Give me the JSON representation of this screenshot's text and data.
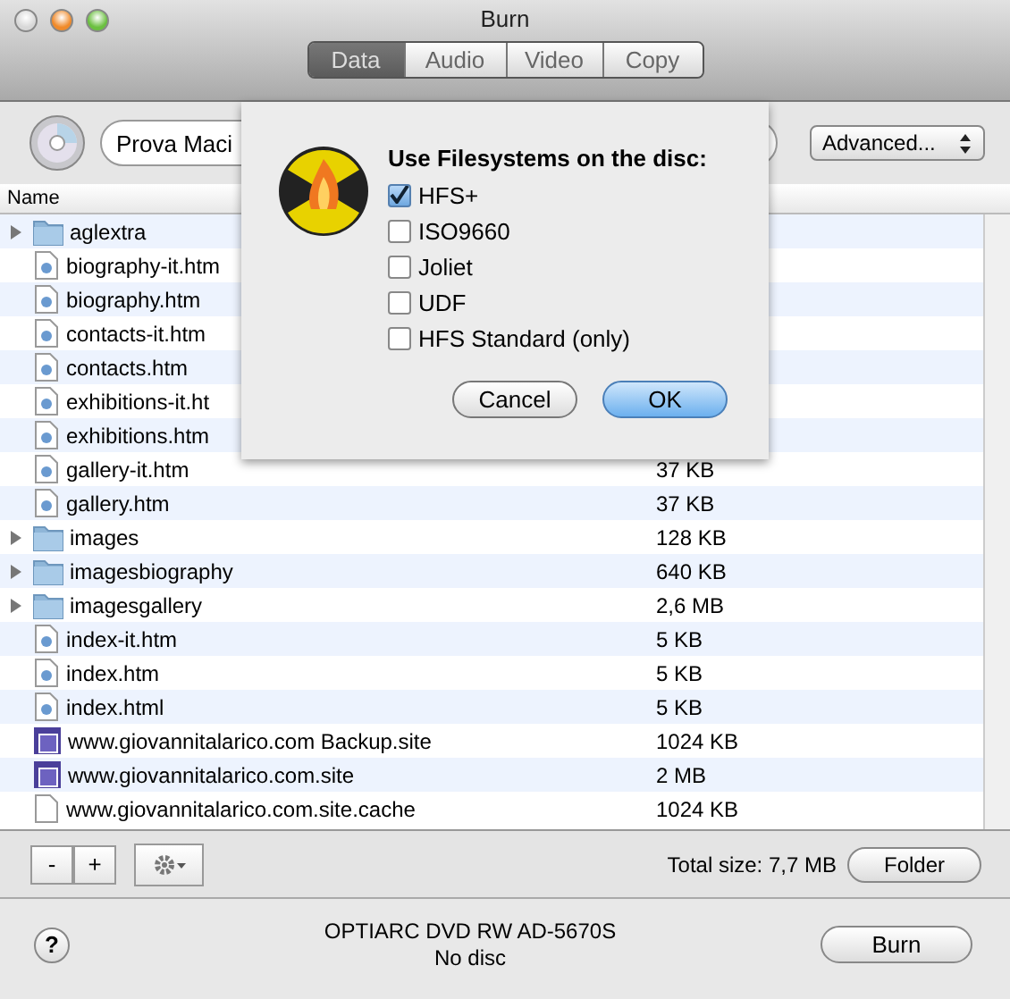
{
  "window": {
    "title": "Burn"
  },
  "tabs": [
    {
      "label": "Data",
      "selected": true
    },
    {
      "label": "Audio",
      "selected": false
    },
    {
      "label": "Video",
      "selected": false
    },
    {
      "label": "Copy",
      "selected": false
    }
  ],
  "disc_name": {
    "value": "Prova Maci"
  },
  "advanced_popup": {
    "label": "Advanced..."
  },
  "table": {
    "columns": [
      "Name"
    ],
    "rows": [
      {
        "kind": "folder",
        "name": "aglextra",
        "size": "",
        "expanded": false
      },
      {
        "kind": "page",
        "name": "biography-it.htm",
        "size": ""
      },
      {
        "kind": "page",
        "name": "biography.htm",
        "size": ""
      },
      {
        "kind": "page",
        "name": "contacts-it.htm",
        "size": ""
      },
      {
        "kind": "page",
        "name": "contacts.htm",
        "size": ""
      },
      {
        "kind": "page",
        "name": "exhibitions-it.ht",
        "size": ""
      },
      {
        "kind": "page",
        "name": "exhibitions.htm",
        "size": ""
      },
      {
        "kind": "page",
        "name": "gallery-it.htm",
        "size": "37 KB"
      },
      {
        "kind": "page",
        "name": "gallery.htm",
        "size": "37 KB"
      },
      {
        "kind": "folder",
        "name": "images",
        "size": "128 KB",
        "expanded": false
      },
      {
        "kind": "folder",
        "name": "imagesbiography",
        "size": "640 KB",
        "expanded": false
      },
      {
        "kind": "folder",
        "name": "imagesgallery",
        "size": "2,6 MB",
        "expanded": false
      },
      {
        "kind": "page",
        "name": "index-it.htm",
        "size": "5 KB"
      },
      {
        "kind": "page",
        "name": "index.htm",
        "size": "5 KB"
      },
      {
        "kind": "page",
        "name": "index.html",
        "size": "5 KB"
      },
      {
        "kind": "site",
        "name": "www.giovannitalarico.com Backup.site",
        "size": "1024 KB"
      },
      {
        "kind": "site",
        "name": "www.giovannitalarico.com.site",
        "size": "2 MB"
      },
      {
        "kind": "file",
        "name": "www.giovannitalarico.com.site.cache",
        "size": "1024 KB"
      }
    ]
  },
  "bottom_bar": {
    "remove_button": "-",
    "add_button": "+",
    "total_size": "Total size: 7,7 MB",
    "folder_button": "Folder"
  },
  "status": {
    "drive": "OPTIARC DVD RW AD-5670S",
    "disc": "No disc",
    "help_button": "?",
    "burn_button": "Burn"
  },
  "sheet": {
    "title": "Use Filesystems on the disc:",
    "options": [
      {
        "label": "HFS+",
        "checked": true
      },
      {
        "label": "ISO9660",
        "checked": false
      },
      {
        "label": "Joliet",
        "checked": false
      },
      {
        "label": "UDF",
        "checked": false
      },
      {
        "label": "HFS Standard (only)",
        "checked": false
      }
    ],
    "cancel_button": "Cancel",
    "ok_button": "OK"
  }
}
